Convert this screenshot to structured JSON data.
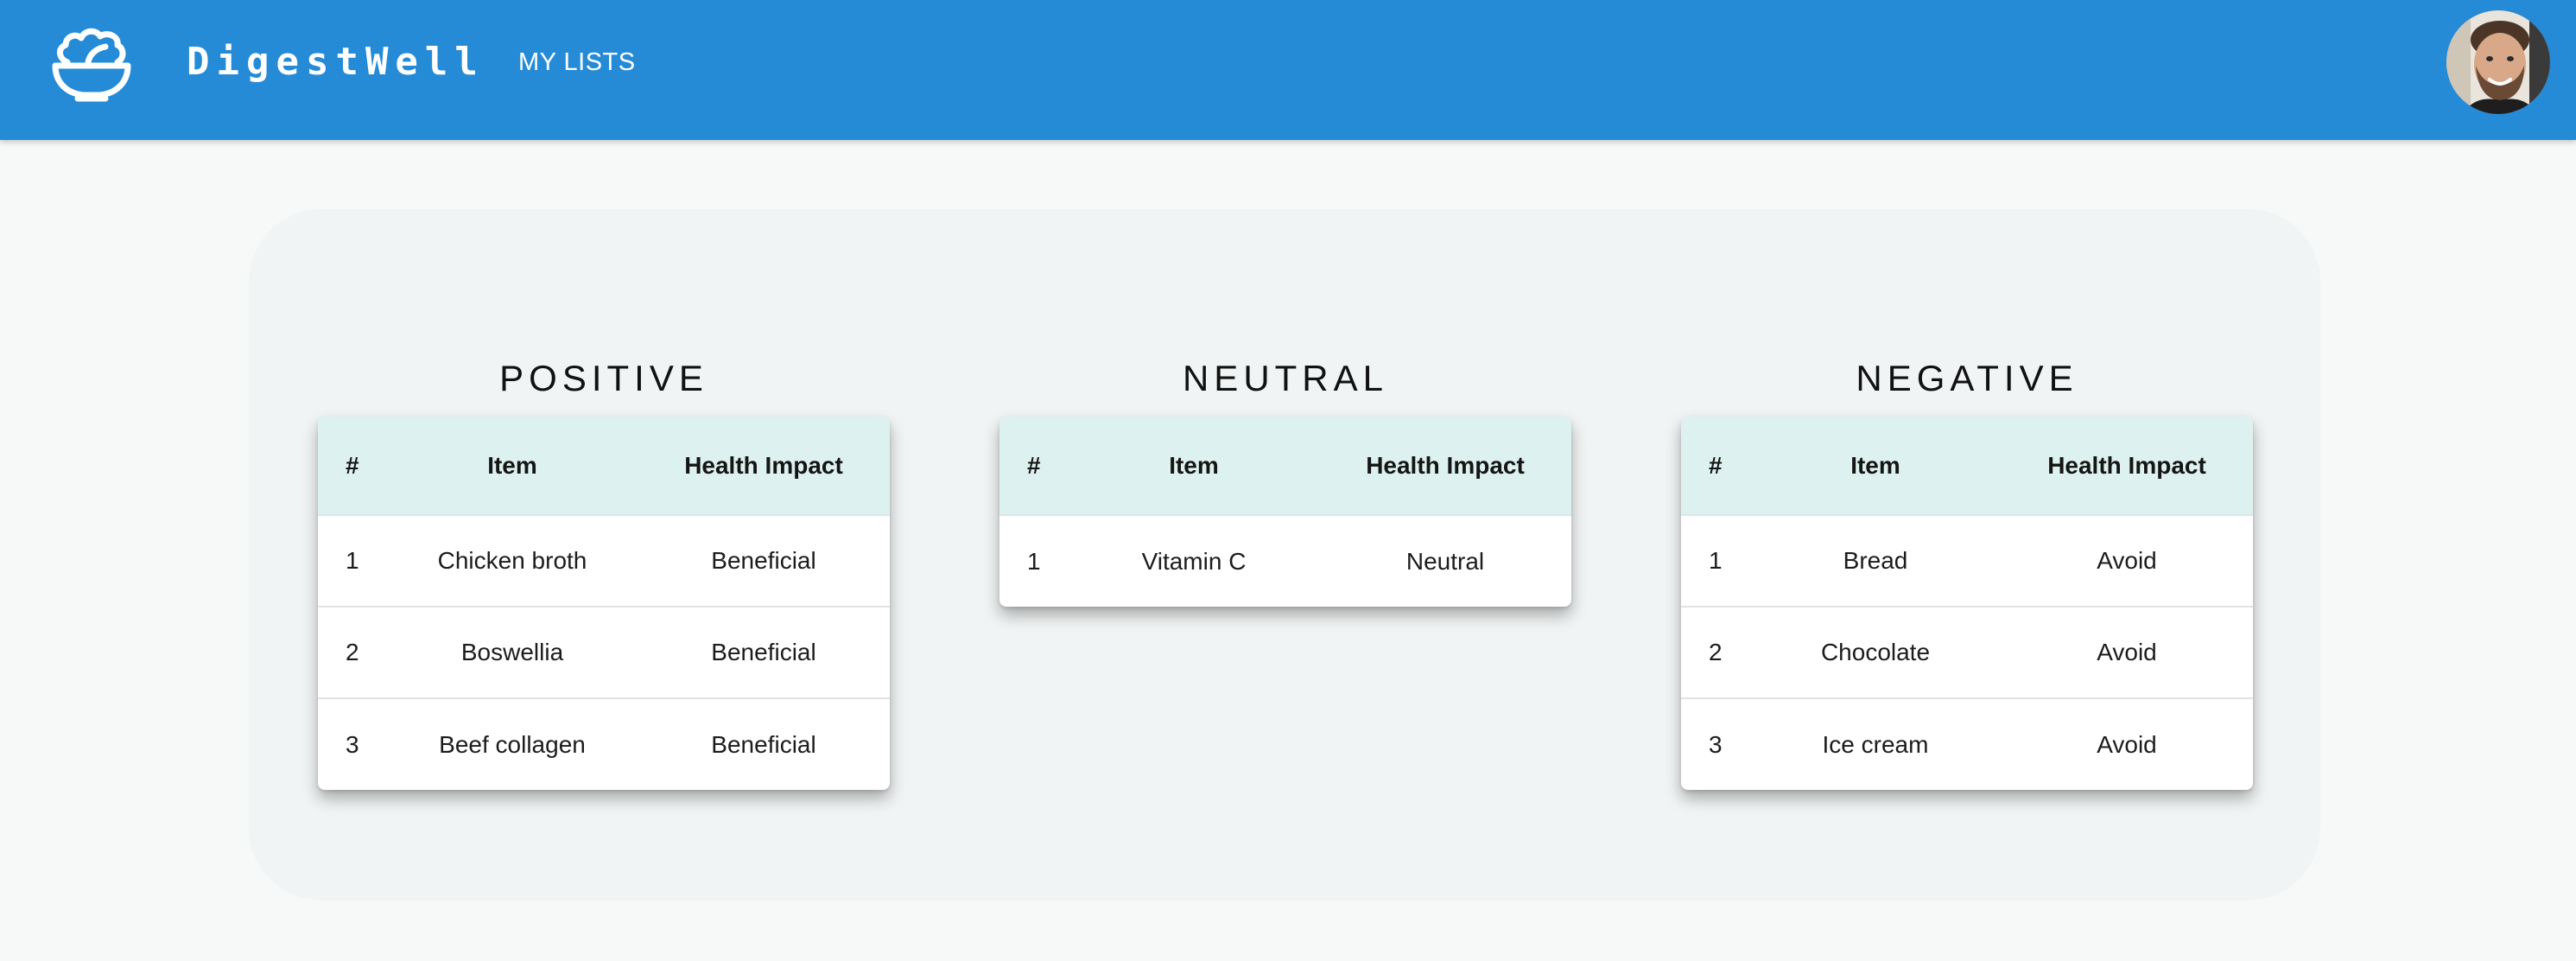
{
  "header": {
    "brand": "DigestWell",
    "nav_my_lists": "MY LISTS",
    "logo_icon": "salad-bowl-icon",
    "avatar_icon": "user-avatar",
    "bar_color": "#268bd6"
  },
  "lists": [
    {
      "title": "POSITIVE",
      "columns": [
        "#",
        "Item",
        "Health Impact"
      ],
      "rows": [
        {
          "num": "1",
          "item": "Chicken broth",
          "impact": "Beneficial"
        },
        {
          "num": "2",
          "item": "Boswellia",
          "impact": "Beneficial"
        },
        {
          "num": "3",
          "item": "Beef collagen",
          "impact": "Beneficial"
        }
      ]
    },
    {
      "title": "NEUTRAL",
      "columns": [
        "#",
        "Item",
        "Health Impact"
      ],
      "rows": [
        {
          "num": "1",
          "item": "Vitamin C",
          "impact": "Neutral"
        }
      ]
    },
    {
      "title": "NEGATIVE",
      "columns": [
        "#",
        "Item",
        "Health Impact"
      ],
      "rows": [
        {
          "num": "1",
          "item": "Bread",
          "impact": "Avoid"
        },
        {
          "num": "2",
          "item": "Chocolate",
          "impact": "Avoid"
        },
        {
          "num": "3",
          "item": "Ice cream",
          "impact": "Avoid"
        }
      ]
    }
  ]
}
